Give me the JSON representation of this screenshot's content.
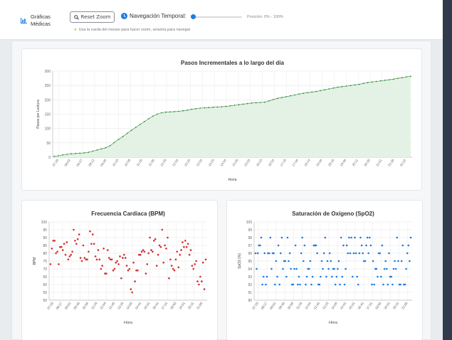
{
  "header": {
    "brand_line1": "Gráficas",
    "brand_line2": "Médicas",
    "reset_label": "Reset Zoom",
    "nav_label": "Navegación Temporal:",
    "position_text": "Posición: 0% - 100%",
    "hint": "Usa la rueda del mouse para hacer zoom, arrastra para navegar",
    "slider_value": 0
  },
  "colors": {
    "steps": "#2e8b3a",
    "steps_fill": "#e3f2e4",
    "heart": "#d32f2f",
    "spo2": "#1e7be6"
  },
  "chart_data": [
    {
      "type": "area",
      "title": "Pasos Incrementales a lo largo del día",
      "xlabel": "Hora",
      "ylabel": "Pasos por Lectura",
      "ylim": [
        0,
        300
      ],
      "yticks": [
        "0",
        "50",
        "100",
        "150",
        "200",
        "250",
        "300"
      ],
      "x_tick_labels": [
        "07:28",
        "08:02",
        "08:37",
        "09:12",
        "09:48",
        "10:23",
        "10:59",
        "11:35",
        "11:56",
        "12:29",
        "12:54",
        "13:25",
        "13:54",
        "14:25",
        "14:54",
        "15:28",
        "15:53",
        "16:23",
        "16:54",
        "17:19",
        "17:44",
        "18:14",
        "18:44",
        "19:16",
        "19:46",
        "20:11",
        "20:26",
        "21:01",
        "21:36",
        "22:22"
      ],
      "values": [
        3,
        5,
        8,
        10,
        12,
        13,
        14,
        15,
        17,
        21,
        25,
        29,
        33,
        40,
        51,
        62,
        72,
        83,
        94,
        104,
        114,
        124,
        134,
        143,
        150,
        155,
        157,
        158,
        159,
        160,
        162,
        164,
        167,
        169,
        171,
        172,
        173,
        174,
        175,
        176,
        177,
        179,
        181,
        183,
        185,
        187,
        189,
        190,
        191,
        192,
        196,
        201,
        205,
        208,
        211,
        214,
        217,
        220,
        223,
        225,
        227,
        229,
        232,
        235,
        238,
        241,
        244,
        246,
        248,
        250,
        252,
        254,
        257,
        260,
        262,
        264,
        266,
        268,
        270,
        272,
        275,
        277,
        280,
        282
      ],
      "grid": true
    },
    {
      "type": "scatter",
      "title": "Frecuencia Cardiaca (BPM)",
      "xlabel": "Hora",
      "ylabel": "BPM",
      "ylim": [
        50,
        100
      ],
      "yticks": [
        "50",
        "55",
        "60",
        "65",
        "70",
        "75",
        "80",
        "85",
        "90",
        "95",
        "100"
      ],
      "x_tick_labels": [
        "07:28",
        "08:27",
        "09:02",
        "09:48",
        "10:56",
        "11:29",
        "12:04",
        "12:45",
        "13:25",
        "14:05",
        "14:41",
        "15:31",
        "16:41",
        "17:31",
        "18:50",
        "19:31",
        "20:11",
        "21:08"
      ],
      "values": [
        73,
        83,
        88,
        88,
        80,
        81,
        73,
        84,
        84,
        82,
        86,
        79,
        87,
        76,
        78,
        79,
        81,
        95,
        88,
        86,
        89,
        92,
        77,
        75,
        85,
        77,
        76,
        76,
        81,
        94,
        86,
        92,
        86,
        78,
        76,
        82,
        76,
        70,
        72,
        83,
        67,
        67,
        82,
        77,
        76,
        76,
        69,
        70,
        74,
        75,
        73,
        78,
        64,
        77,
        79,
        77,
        72,
        69,
        70,
        57,
        55,
        74,
        62,
        69,
        69,
        79,
        79,
        81,
        82,
        81,
        67,
        73,
        80,
        90,
        82,
        81,
        88,
        89,
        72,
        79,
        85,
        84,
        95,
        74,
        85,
        83,
        90,
        64,
        76,
        72,
        70,
        69,
        76,
        81,
        71,
        79,
        82,
        87,
        84,
        88,
        84,
        86,
        79,
        82,
        72,
        70,
        73,
        75,
        62,
        60,
        65,
        62,
        74,
        57,
        76
      ],
      "grid": true
    },
    {
      "type": "scatter",
      "title": "Saturación de Oxígeno (SpO2)",
      "xlabel": "Hora",
      "ylabel": "SpO2 (%)",
      "ylim": [
        90,
        100
      ],
      "yticks": [
        "90",
        "91",
        "92",
        "93",
        "94",
        "95",
        "96",
        "97",
        "98",
        "99",
        "100"
      ],
      "x_tick_labels": [
        "07:28",
        "08:27",
        "09:02",
        "09:48",
        "10:56",
        "11:29",
        "12:04",
        "12:45",
        "13:25",
        "14:05",
        "14:41",
        "15:31",
        "16:41",
        "17:31",
        "18:50",
        "19:31",
        "20:11",
        "21:08"
      ],
      "values": [
        96,
        94,
        96,
        97,
        97,
        98,
        92,
        93,
        96,
        92,
        93,
        96,
        96,
        98,
        94,
        96,
        96,
        92,
        95,
        93,
        97,
        92,
        96,
        98,
        94,
        95,
        95,
        93,
        98,
        95,
        96,
        94,
        92,
        92,
        94,
        97,
        94,
        92,
        93,
        92,
        96,
        98,
        95,
        97,
        92,
        93,
        94,
        94,
        95,
        92,
        93,
        97,
        97,
        97,
        96,
        92,
        92,
        93,
        95,
        94,
        96,
        98,
        93,
        95,
        94,
        96,
        95,
        93,
        94,
        94,
        92,
        93,
        94,
        95,
        92,
        98,
        93,
        97,
        92,
        94,
        97,
        96,
        98,
        96,
        98,
        93,
        96,
        98,
        96,
        93,
        92,
        96,
        98,
        97,
        96,
        95,
        95,
        97,
        98,
        96,
        98,
        97,
        92,
        95,
        92,
        94,
        94,
        93,
        96,
        96,
        93,
        97,
        92,
        94,
        95,
        94,
        92,
        96,
        93,
        93,
        92,
        94,
        95,
        94,
        98,
        95,
        92,
        92,
        95,
        97,
        92,
        92,
        94,
        96,
        97,
        95,
        98
      ],
      "grid": true
    }
  ]
}
